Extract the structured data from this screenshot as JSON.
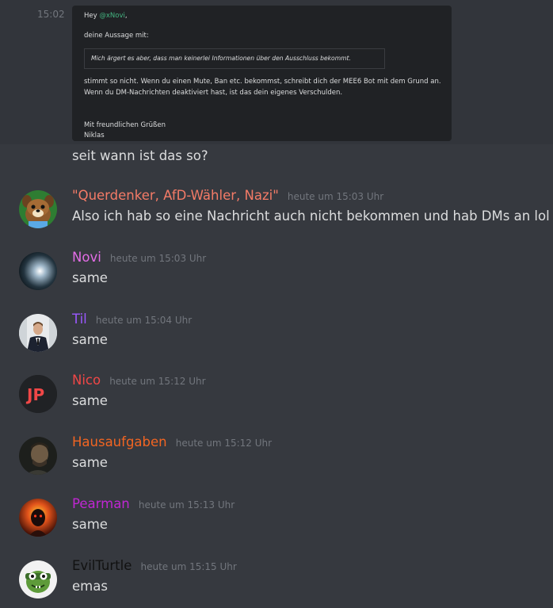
{
  "top": {
    "timestamp": "15:02",
    "embed": {
      "greeting_prefix": "Hey",
      "mention": "@xNovi",
      "greeting_suffix": ",",
      "line_intro": "deine Aussage mit:",
      "quote": "Mich ärgert es aber, dass man keinerlei Informationen über den Ausschluss bekommt.",
      "line1": "stimmt so nicht. Wenn du einen Mute, Ban etc. bekommst, schreibt dich der MEE6 Bot mit dem Grund an.",
      "line2": "Wenn du DM-Nachrichten deaktiviert hast, ist das dein eigenes Verschulden.",
      "closing": "Mit freundlichen Grüßen",
      "signature": "Niklas"
    },
    "followup": "seit wann ist das so?"
  },
  "colors": {
    "background": "#36393f",
    "timestamp": "#72767d",
    "text": "#dcddde",
    "mention": "#43b581"
  },
  "messages": [
    {
      "username": "\"Querdenker, AfD-Wähler, Nazi\"",
      "color": "#f47b67",
      "time": "heute um 15:03 Uhr",
      "text": "Also ich hab so eine Nachricht auch nicht bekommen und hab DMs an lol",
      "avatar": "animal-avatar"
    },
    {
      "username": "Novi",
      "color": "#e36de6",
      "time": "heute um 15:03 Uhr",
      "text": "same",
      "avatar": "light-orb-avatar"
    },
    {
      "username": "Til",
      "color": "#9b59ff",
      "time": "heute um 15:04 Uhr",
      "text": "same",
      "avatar": "suit-man-avatar"
    },
    {
      "username": "Nico",
      "color": "#f04747",
      "time": "heute um 15:12 Uhr",
      "text": "same",
      "avatar": "jp-logo-avatar"
    },
    {
      "username": "Hausaufgaben",
      "color": "#f26522",
      "time": "heute um 15:12 Uhr",
      "text": "same",
      "avatar": "dark-portrait-avatar"
    },
    {
      "username": "Pearman",
      "color": "#c026d3",
      "time": "heute um 15:13 Uhr",
      "text": "same",
      "avatar": "fire-character-avatar"
    },
    {
      "username": "EvilTurtle",
      "color": "#111111",
      "time": "heute um 15:15 Uhr",
      "text": "emas",
      "avatar": "turtle-avatar"
    }
  ],
  "avatar_logo_text": "JP"
}
